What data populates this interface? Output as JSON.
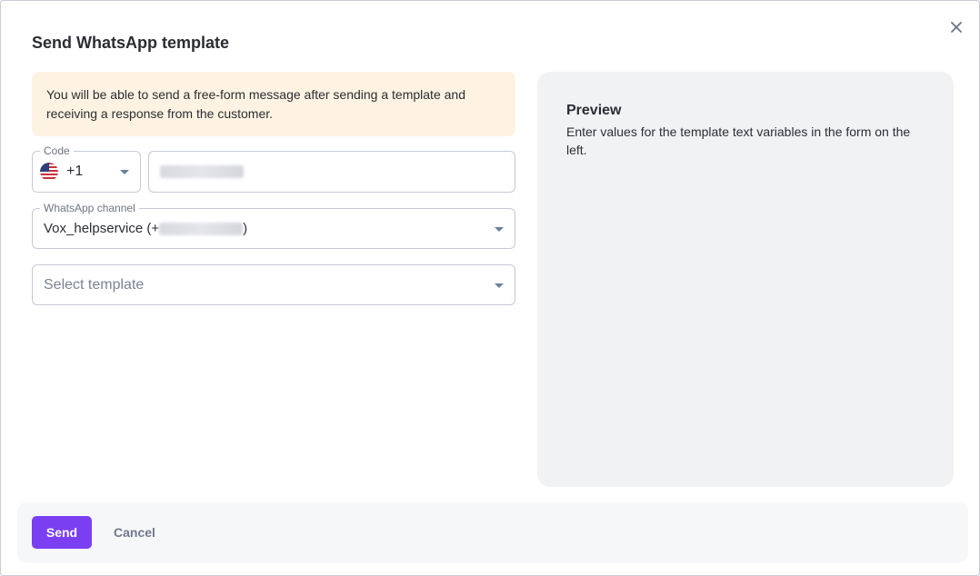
{
  "dialog": {
    "title": "Send WhatsApp template",
    "close_icon": "close-icon"
  },
  "notice": {
    "text": "You will be able to send a free-form message after sending a template and receiving a response from the customer."
  },
  "code_field": {
    "legend": "Code",
    "value": "+1",
    "flag_icon": "us-flag-icon"
  },
  "phone_field": {
    "value_redacted": true
  },
  "channel_field": {
    "legend": "WhatsApp channel",
    "value_prefix": "Vox_helpservice (+",
    "value_suffix": ")"
  },
  "template_field": {
    "placeholder": "Select template"
  },
  "preview": {
    "title": "Preview",
    "text": "Enter values for the template text variables in the form on the left."
  },
  "footer": {
    "send_label": "Send",
    "cancel_label": "Cancel"
  },
  "colors": {
    "accent": "#7b3ff2",
    "notice_bg": "#fef3e2",
    "preview_bg": "#f1f2f4"
  }
}
